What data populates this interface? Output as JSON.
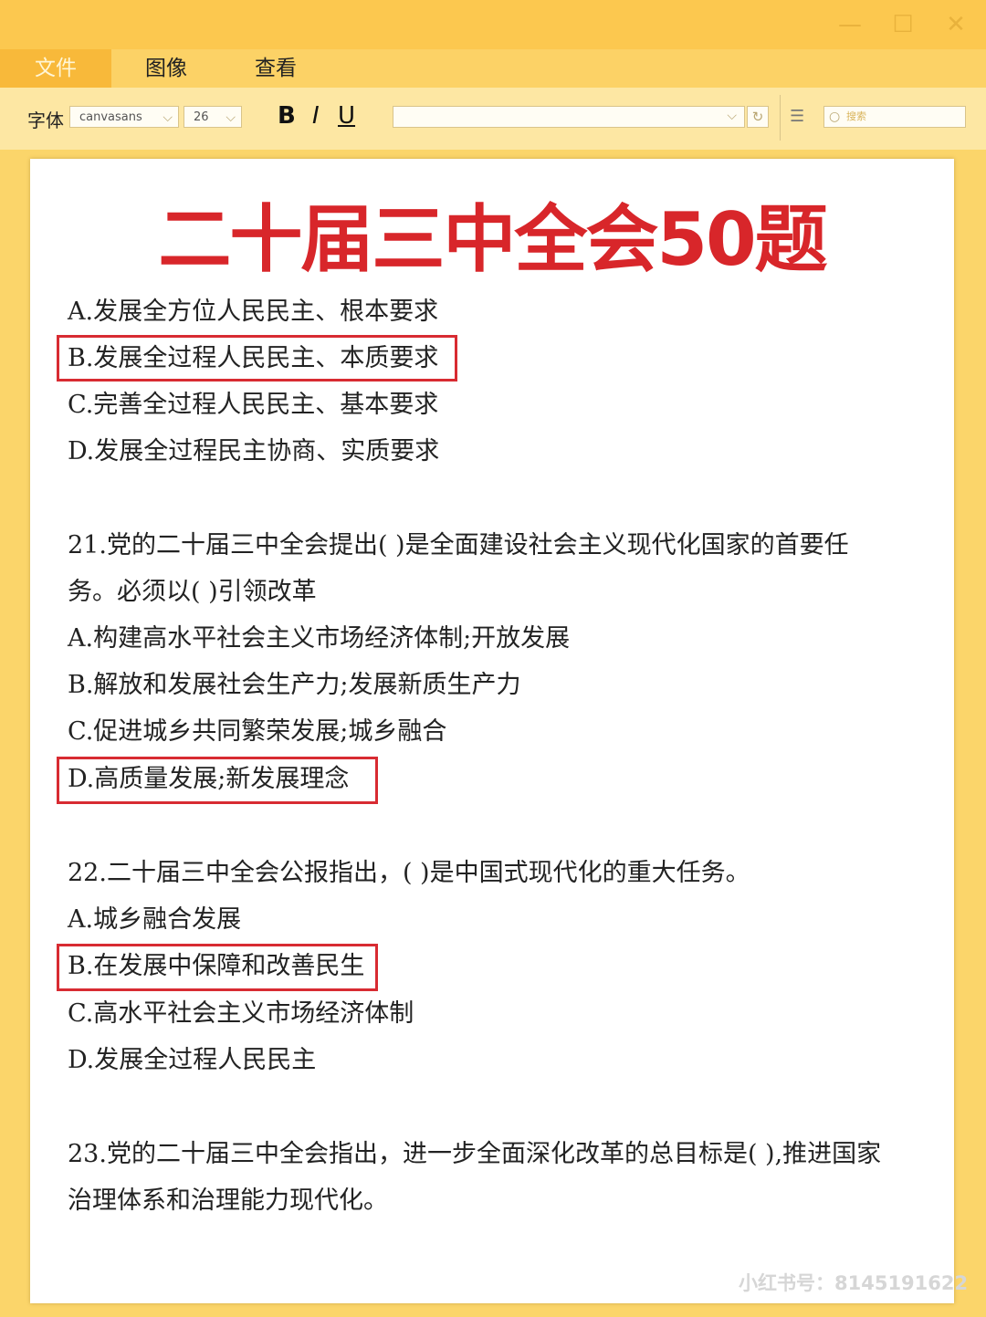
{
  "window": {
    "controls": [
      "minimize-icon",
      "maximize-icon",
      "close-icon"
    ]
  },
  "menu": {
    "file": "文件",
    "image": "图像",
    "view": "查看"
  },
  "toolbar": {
    "font_label": "字体",
    "font_value": "canvasans",
    "size_value": "26",
    "bold": "B",
    "italic": "I",
    "underline": "U",
    "search_placeholder": "搜索"
  },
  "document": {
    "title": "二十届三中全会50题",
    "lines": [
      "A.发展全方位人民民主、根本要求",
      "B.发展全过程人民民主、本质要求",
      "C.完善全过程人民民主、基本要求",
      "D.发展全过程民主协商、实质要求",
      "21.党的二十届三中全会提出(    )是全面建设社会主义现代化国家的首要任",
      "务。必须以(    )引领改革",
      "A.构建高水平社会主义市场经济体制;开放发展",
      "B.解放和发展社会生产力;发展新质生产力",
      "C.促进城乡共同繁荣发展;城乡融合",
      "D.高质量发展;新发展理念",
      "22.二十届三中全会公报指出，(    )是中国式现代化的重大任务。",
      "A.城乡融合发展",
      "B.在发展中保障和改善民生",
      "C.高水平社会主义市场经济体制",
      "D.发展全过程人民民主",
      "23.党的二十届三中全会指出，进一步全面深化改革的总目标是(    ),推进国家",
      "治理体系和治理能力现代化。"
    ],
    "highlighted_answers": [
      "B",
      "D",
      "B"
    ],
    "highlight_color": "#d82b32"
  },
  "watermark": "小红书号：8145191622",
  "colors": {
    "background": "#fbd56a",
    "title": "#d8262a",
    "active_menu": "#f8b93a"
  }
}
